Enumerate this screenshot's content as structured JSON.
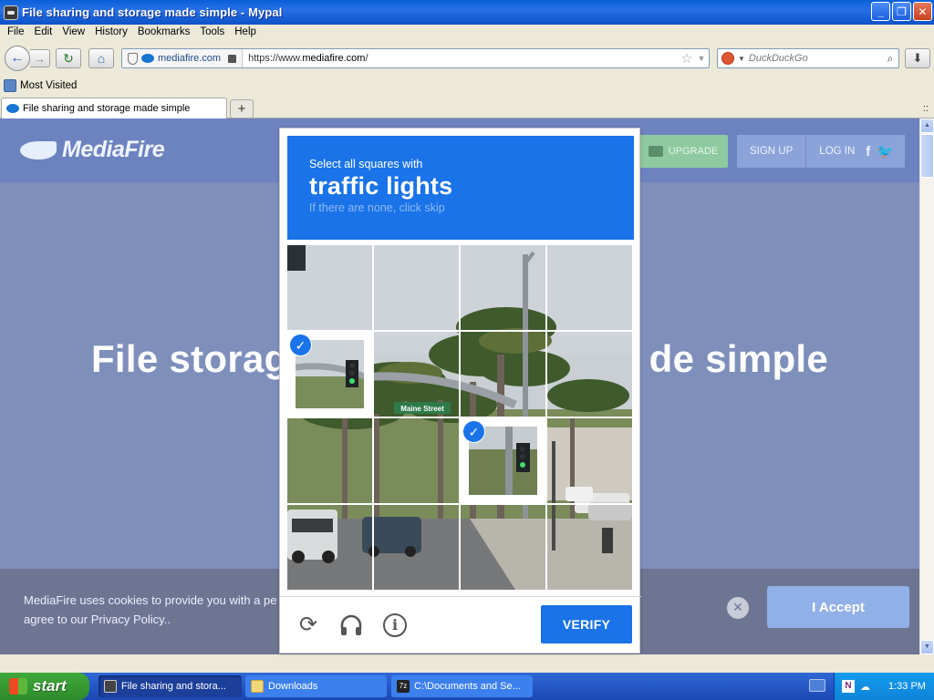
{
  "window": {
    "title": "File sharing and storage made simple - Mypal",
    "minimize": "_",
    "restore": "❐",
    "close": "✕"
  },
  "menu": {
    "items": [
      "File",
      "Edit",
      "View",
      "History",
      "Bookmarks",
      "Tools",
      "Help"
    ]
  },
  "nav": {
    "identity": "mediafire.com",
    "url_prefix": "https://www.",
    "url_host": "mediafire.com",
    "url_suffix": "/",
    "search_placeholder": "DuckDuckGo"
  },
  "bookmarks": {
    "most_visited": "Most Visited"
  },
  "tabs": {
    "active_title": "File sharing and storage made simple",
    "new_tab": "+",
    "tab_list": "::"
  },
  "site": {
    "logo": "MediaFire",
    "upgrade": "UPGRADE",
    "signup": "SIGN UP",
    "login": "LOG IN",
    "hero_left": "File storag",
    "hero_right": "de simple",
    "cookie_line1": "MediaFire uses cookies to provide you with a pe",
    "cookie_line2": "agree to our Privacy Policy..",
    "accept": "I Accept",
    "close_x": "✕"
  },
  "captcha": {
    "instruction": "Select all squares with",
    "target": "traffic lights",
    "hint": "If there are none, click skip",
    "street_sign": "Maine Street",
    "verify": "VERIFY",
    "selected_tiles": [
      [
        1,
        0
      ],
      [
        2,
        2
      ]
    ],
    "reload_icon": "⟳",
    "audio_icon": "🎧",
    "info_icon": "i"
  },
  "taskbar": {
    "start": "start",
    "tasks": [
      {
        "label": "File sharing and stora...",
        "active": true
      },
      {
        "label": "Downloads",
        "active": false
      },
      {
        "label": "C:\\Documents and Se...",
        "active": false
      }
    ],
    "tray_n": "N",
    "clock": "1:33 PM"
  },
  "colors": {
    "captcha_blue": "#1a73e8",
    "page_overlay": "#7e8fbb",
    "xp_title": "#0a5fd8"
  }
}
